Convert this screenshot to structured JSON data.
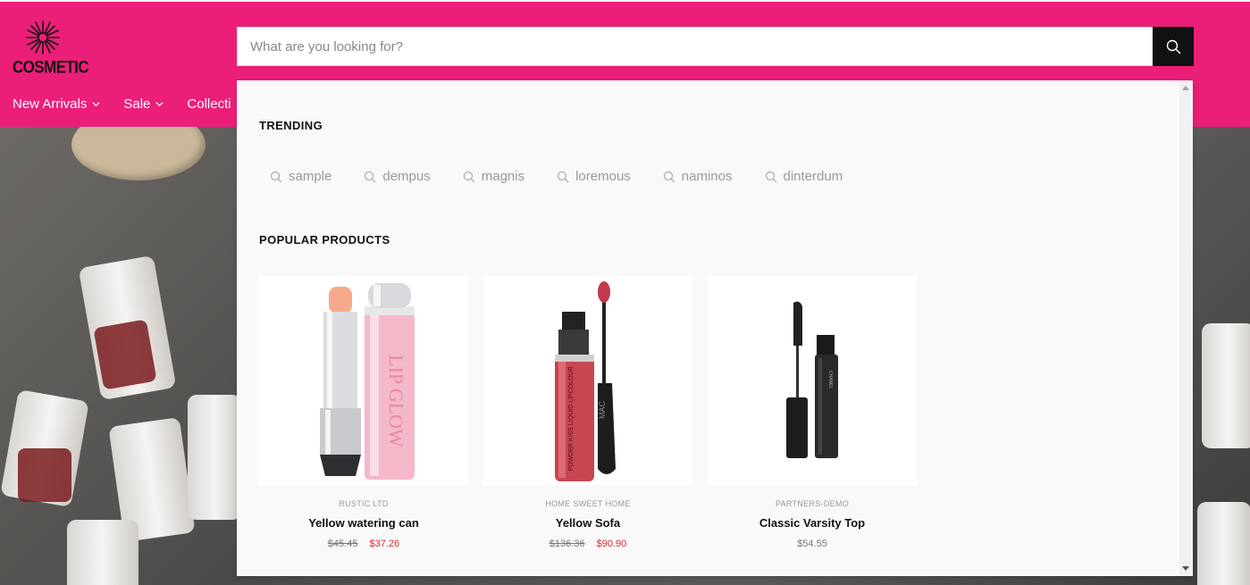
{
  "brand": {
    "logo_text": "COSMETIC"
  },
  "nav": {
    "items": [
      "New Arrivals",
      "Sale",
      "Collecti"
    ]
  },
  "search": {
    "placeholder": "What are you looking for?",
    "value": ""
  },
  "dropdown": {
    "trending_title": "TRENDING",
    "trending": [
      "sample",
      "dempus",
      "magnis",
      "loremous",
      "naminos",
      "dinterdum"
    ],
    "popular_title": "POPULAR PRODUCTS",
    "products": [
      {
        "vendor": "RUSTIC LTD",
        "name": "Yellow watering can",
        "price_old": "$45.45",
        "price_new": "$37.26"
      },
      {
        "vendor": "HOME SWEET HOME",
        "name": "Yellow Sofa",
        "price_old": "$136.36",
        "price_new": "$90.90"
      },
      {
        "vendor": "PARTNERS-DEMO",
        "name": "Classic Varsity Top",
        "price": "$54.55"
      }
    ]
  },
  "colors": {
    "header_bg": "#ec1f78",
    "search_button": "#111111",
    "sale_price": "#e2282f"
  },
  "icons": {
    "search": "search-icon",
    "chevron": "chevron-down-icon",
    "logo": "starburst-logo-icon"
  }
}
